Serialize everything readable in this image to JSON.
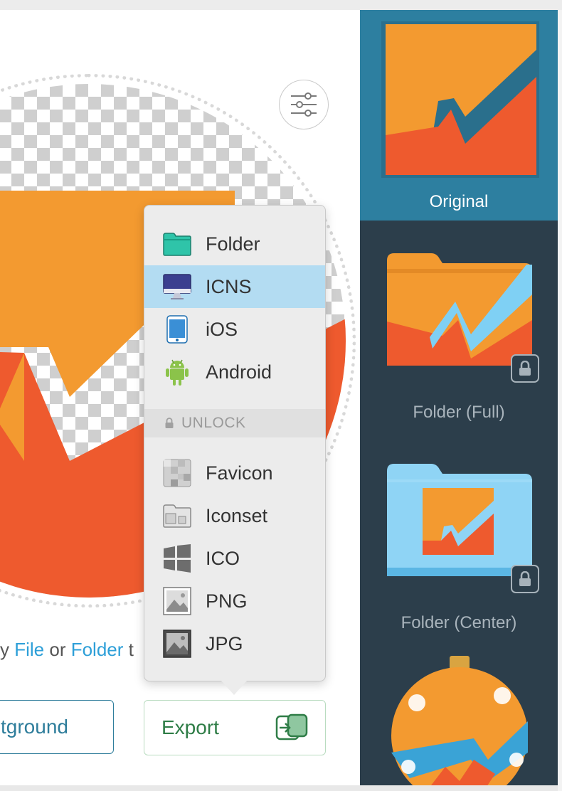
{
  "hint": {
    "prefix": "y ",
    "file_link": "File",
    "or": " or ",
    "folder_link": "Folder",
    "suffix": " t"
  },
  "buttons": {
    "background_label": "tground",
    "export_label": "Export"
  },
  "export_menu": {
    "items": [
      {
        "label": "Folder",
        "icon": "folder-icon"
      },
      {
        "label": "ICNS",
        "icon": "imac-icon",
        "selected": true
      },
      {
        "label": "iOS",
        "icon": "iphone-icon"
      },
      {
        "label": "Android",
        "icon": "android-icon"
      }
    ],
    "section_label": "UNLOCK",
    "locked_items": [
      {
        "label": "Favicon",
        "icon": "favicon-icon"
      },
      {
        "label": "Iconset",
        "icon": "iconset-icon"
      },
      {
        "label": "ICO",
        "icon": "windows-icon"
      },
      {
        "label": "PNG",
        "icon": "png-image-icon"
      },
      {
        "label": "JPG",
        "icon": "jpg-image-icon"
      }
    ]
  },
  "sidebar": {
    "items": [
      {
        "label": "Original",
        "selected": true
      },
      {
        "label": "Folder (Full)",
        "locked": true
      },
      {
        "label": "Folder (Center)",
        "locked": true
      },
      {
        "label": "",
        "style": "ornament"
      }
    ]
  },
  "colors": {
    "orange": "#f39a30",
    "red_orange": "#ee5a2e",
    "teal_blue": "#2d7fa0",
    "sidebar_bg": "#2c3e4b",
    "selection": "#b3dcf2",
    "link": "#2d9fd8"
  }
}
